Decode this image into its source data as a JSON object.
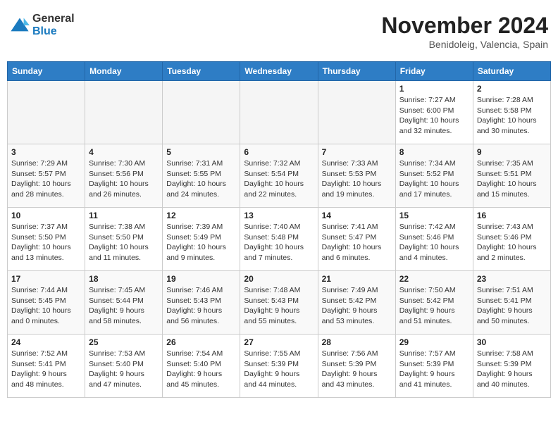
{
  "header": {
    "logo": {
      "general": "General",
      "blue": "Blue"
    },
    "title": "November 2024",
    "location": "Benidoleig, Valencia, Spain"
  },
  "weekdays": [
    "Sunday",
    "Monday",
    "Tuesday",
    "Wednesday",
    "Thursday",
    "Friday",
    "Saturday"
  ],
  "weeks": [
    [
      {
        "day": "",
        "info": ""
      },
      {
        "day": "",
        "info": ""
      },
      {
        "day": "",
        "info": ""
      },
      {
        "day": "",
        "info": ""
      },
      {
        "day": "",
        "info": ""
      },
      {
        "day": "1",
        "info": "Sunrise: 7:27 AM\nSunset: 6:00 PM\nDaylight: 10 hours and 32 minutes."
      },
      {
        "day": "2",
        "info": "Sunrise: 7:28 AM\nSunset: 5:58 PM\nDaylight: 10 hours and 30 minutes."
      }
    ],
    [
      {
        "day": "3",
        "info": "Sunrise: 7:29 AM\nSunset: 5:57 PM\nDaylight: 10 hours and 28 minutes."
      },
      {
        "day": "4",
        "info": "Sunrise: 7:30 AM\nSunset: 5:56 PM\nDaylight: 10 hours and 26 minutes."
      },
      {
        "day": "5",
        "info": "Sunrise: 7:31 AM\nSunset: 5:55 PM\nDaylight: 10 hours and 24 minutes."
      },
      {
        "day": "6",
        "info": "Sunrise: 7:32 AM\nSunset: 5:54 PM\nDaylight: 10 hours and 22 minutes."
      },
      {
        "day": "7",
        "info": "Sunrise: 7:33 AM\nSunset: 5:53 PM\nDaylight: 10 hours and 19 minutes."
      },
      {
        "day": "8",
        "info": "Sunrise: 7:34 AM\nSunset: 5:52 PM\nDaylight: 10 hours and 17 minutes."
      },
      {
        "day": "9",
        "info": "Sunrise: 7:35 AM\nSunset: 5:51 PM\nDaylight: 10 hours and 15 minutes."
      }
    ],
    [
      {
        "day": "10",
        "info": "Sunrise: 7:37 AM\nSunset: 5:50 PM\nDaylight: 10 hours and 13 minutes."
      },
      {
        "day": "11",
        "info": "Sunrise: 7:38 AM\nSunset: 5:50 PM\nDaylight: 10 hours and 11 minutes."
      },
      {
        "day": "12",
        "info": "Sunrise: 7:39 AM\nSunset: 5:49 PM\nDaylight: 10 hours and 9 minutes."
      },
      {
        "day": "13",
        "info": "Sunrise: 7:40 AM\nSunset: 5:48 PM\nDaylight: 10 hours and 7 minutes."
      },
      {
        "day": "14",
        "info": "Sunrise: 7:41 AM\nSunset: 5:47 PM\nDaylight: 10 hours and 6 minutes."
      },
      {
        "day": "15",
        "info": "Sunrise: 7:42 AM\nSunset: 5:46 PM\nDaylight: 10 hours and 4 minutes."
      },
      {
        "day": "16",
        "info": "Sunrise: 7:43 AM\nSunset: 5:46 PM\nDaylight: 10 hours and 2 minutes."
      }
    ],
    [
      {
        "day": "17",
        "info": "Sunrise: 7:44 AM\nSunset: 5:45 PM\nDaylight: 10 hours and 0 minutes."
      },
      {
        "day": "18",
        "info": "Sunrise: 7:45 AM\nSunset: 5:44 PM\nDaylight: 9 hours and 58 minutes."
      },
      {
        "day": "19",
        "info": "Sunrise: 7:46 AM\nSunset: 5:43 PM\nDaylight: 9 hours and 56 minutes."
      },
      {
        "day": "20",
        "info": "Sunrise: 7:48 AM\nSunset: 5:43 PM\nDaylight: 9 hours and 55 minutes."
      },
      {
        "day": "21",
        "info": "Sunrise: 7:49 AM\nSunset: 5:42 PM\nDaylight: 9 hours and 53 minutes."
      },
      {
        "day": "22",
        "info": "Sunrise: 7:50 AM\nSunset: 5:42 PM\nDaylight: 9 hours and 51 minutes."
      },
      {
        "day": "23",
        "info": "Sunrise: 7:51 AM\nSunset: 5:41 PM\nDaylight: 9 hours and 50 minutes."
      }
    ],
    [
      {
        "day": "24",
        "info": "Sunrise: 7:52 AM\nSunset: 5:41 PM\nDaylight: 9 hours and 48 minutes."
      },
      {
        "day": "25",
        "info": "Sunrise: 7:53 AM\nSunset: 5:40 PM\nDaylight: 9 hours and 47 minutes."
      },
      {
        "day": "26",
        "info": "Sunrise: 7:54 AM\nSunset: 5:40 PM\nDaylight: 9 hours and 45 minutes."
      },
      {
        "day": "27",
        "info": "Sunrise: 7:55 AM\nSunset: 5:39 PM\nDaylight: 9 hours and 44 minutes."
      },
      {
        "day": "28",
        "info": "Sunrise: 7:56 AM\nSunset: 5:39 PM\nDaylight: 9 hours and 43 minutes."
      },
      {
        "day": "29",
        "info": "Sunrise: 7:57 AM\nSunset: 5:39 PM\nDaylight: 9 hours and 41 minutes."
      },
      {
        "day": "30",
        "info": "Sunrise: 7:58 AM\nSunset: 5:39 PM\nDaylight: 9 hours and 40 minutes."
      }
    ]
  ]
}
